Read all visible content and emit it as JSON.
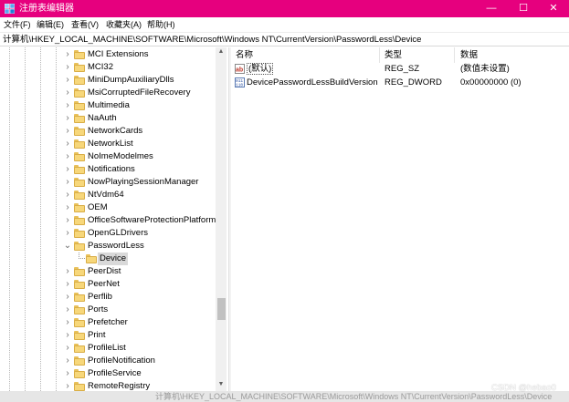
{
  "window": {
    "title": "注册表编辑器",
    "controls": {
      "minimize": "—",
      "maximize": "☐",
      "close": "✕"
    },
    "accent_color": "#e6007e"
  },
  "menu": [
    "文件(F)",
    "编辑(E)",
    "查看(V)",
    "收藏夹(A)",
    "帮助(H)"
  ],
  "address": {
    "path": "计算机\\HKEY_LOCAL_MACHINE\\SOFTWARE\\Microsoft\\Windows NT\\CurrentVersion\\PasswordLess\\Device"
  },
  "tree": {
    "items": [
      {
        "label": "MCI Extensions",
        "expander": "chevron-right"
      },
      {
        "label": "MCI32",
        "expander": "chevron-right"
      },
      {
        "label": "MiniDumpAuxiliaryDlls",
        "expander": "chevron-right"
      },
      {
        "label": "MsiCorruptedFileRecovery",
        "expander": "chevron-right"
      },
      {
        "label": "Multimedia",
        "expander": "chevron-right"
      },
      {
        "label": "NaAuth",
        "expander": "chevron-right"
      },
      {
        "label": "NetworkCards",
        "expander": "chevron-right"
      },
      {
        "label": "NetworkList",
        "expander": "chevron-right"
      },
      {
        "label": "NoImeModelmes",
        "expander": "chevron-right"
      },
      {
        "label": "Notifications",
        "expander": "chevron-right"
      },
      {
        "label": "NowPlayingSessionManager",
        "expander": "chevron-right"
      },
      {
        "label": "NtVdm64",
        "expander": "chevron-right"
      },
      {
        "label": "OEM",
        "expander": "chevron-right"
      },
      {
        "label": "OfficeSoftwareProtectionPlatform",
        "expander": "chevron-right"
      },
      {
        "label": "OpenGLDrivers",
        "expander": "chevron-right"
      },
      {
        "label": "PasswordLess",
        "expander": "chevron-down"
      },
      {
        "label": "Device",
        "expander": "none",
        "selected": true
      },
      {
        "label": "PeerDist",
        "expander": "chevron-right"
      },
      {
        "label": "PeerNet",
        "expander": "chevron-right"
      },
      {
        "label": "Perflib",
        "expander": "chevron-right"
      },
      {
        "label": "Ports",
        "expander": "chevron-right"
      },
      {
        "label": "Prefetcher",
        "expander": "chevron-right"
      },
      {
        "label": "Print",
        "expander": "chevron-right"
      },
      {
        "label": "ProfileList",
        "expander": "chevron-right"
      },
      {
        "label": "ProfileNotification",
        "expander": "chevron-right"
      },
      {
        "label": "ProfileService",
        "expander": "chevron-right"
      },
      {
        "label": "RemoteRegistry",
        "expander": "chevron-right"
      }
    ],
    "scrollbar": {
      "up": "▲",
      "down": "▼"
    }
  },
  "values": {
    "columns": [
      "名称",
      "类型",
      "数据"
    ],
    "rows": [
      {
        "name": "(默认)",
        "type": "REG_SZ",
        "data": "(数值未设置)",
        "icon": "string-value-icon"
      },
      {
        "name": "DevicePasswordLessBuildVersion",
        "type": "REG_DWORD",
        "data": "0x00000000 (0)",
        "icon": "binary-value-icon"
      }
    ]
  },
  "watermark": "CSDN @hebao0"
}
